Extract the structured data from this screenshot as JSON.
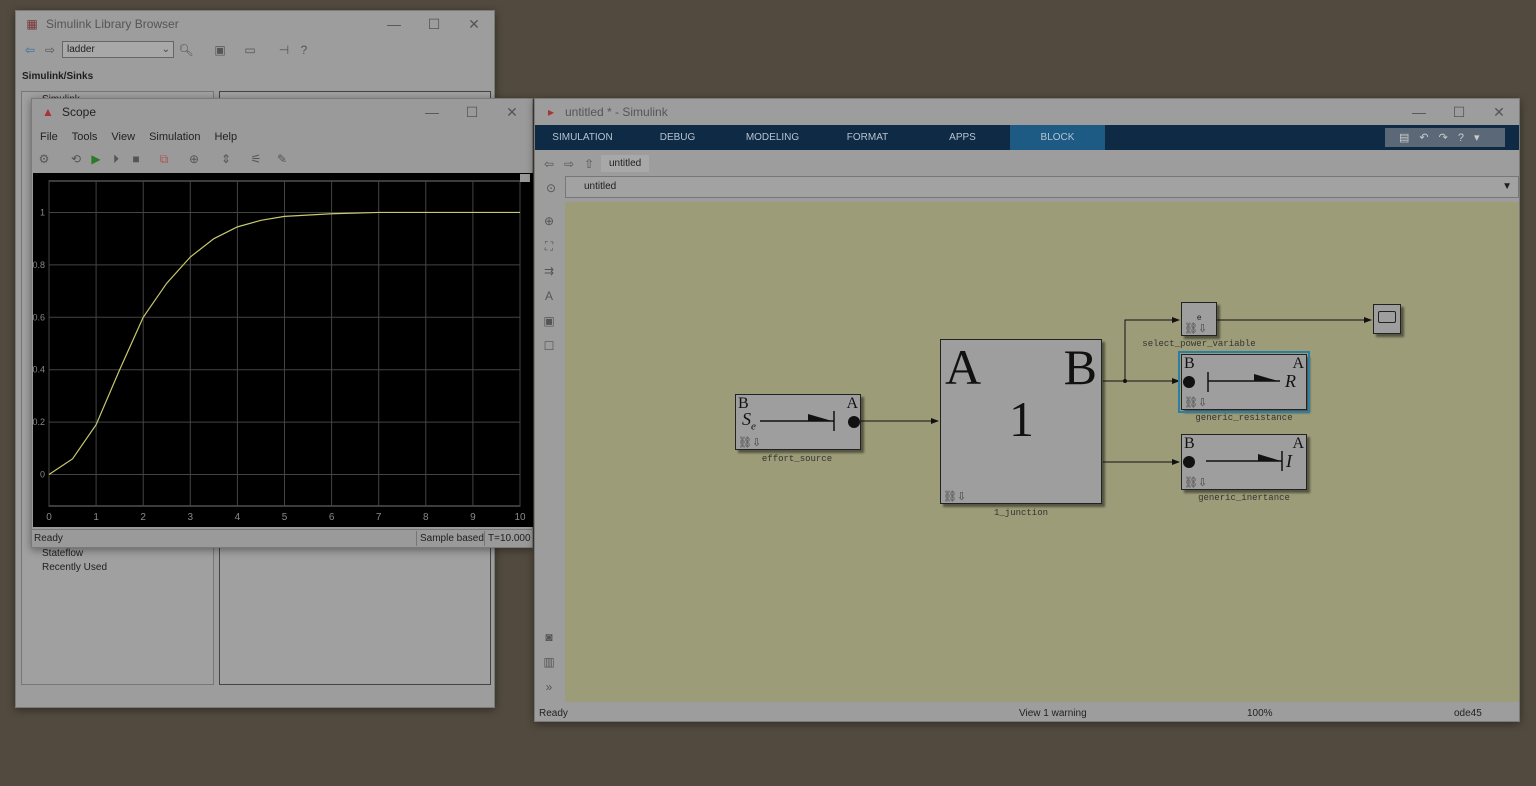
{
  "library_browser": {
    "title": "Simulink Library Browser",
    "search_value": "ladder",
    "path": "Simulink/Sinks",
    "tree": [
      "Simulink",
      "Stateflow",
      "Recently Used"
    ]
  },
  "scope": {
    "title": "Scope",
    "menu": [
      "File",
      "Tools",
      "View",
      "Simulation",
      "Help"
    ],
    "status": "Ready",
    "sample_mode": "Sample based",
    "time": "T=10.000",
    "line_color": "#c8c870"
  },
  "chart_data": {
    "type": "line",
    "x": [
      0,
      0.5,
      1,
      1.5,
      2,
      2.5,
      3,
      3.5,
      4,
      4.5,
      5,
      6,
      7,
      8,
      9,
      10
    ],
    "values": [
      0,
      0.06,
      0.19,
      0.4,
      0.6,
      0.73,
      0.83,
      0.9,
      0.945,
      0.97,
      0.985,
      0.995,
      1,
      1,
      1,
      1
    ],
    "xlim": [
      0,
      10
    ],
    "ylim": [
      -0.12,
      1.12
    ],
    "xticks": [
      "0",
      "1",
      "2",
      "3",
      "4",
      "5",
      "6",
      "7",
      "8",
      "9",
      "10"
    ],
    "yticks": [
      "0",
      "0.2",
      "0.4",
      "0.6",
      "0.8",
      "1"
    ],
    "grid": true,
    "background": "#000000"
  },
  "simulink": {
    "title": "untitled * - Simulink",
    "tabs": [
      "SIMULATION",
      "DEBUG",
      "MODELING",
      "FORMAT",
      "APPS",
      "BLOCK"
    ],
    "active_tab": "BLOCK",
    "breadcrumb_tab": "untitled",
    "address": "untitled",
    "status": {
      "left": "Ready",
      "warning": "View 1 warning",
      "zoom": "100%",
      "solver": "ode45"
    },
    "blocks": {
      "effort_source": "effort_source",
      "junction": "1_junction",
      "select": "select_power_variable",
      "resistance": "generic_resistance",
      "inertance": "generic_inertance"
    },
    "glyphs": {
      "a": "A",
      "b": "B",
      "one": "1",
      "se": "S",
      "se_sub": "e",
      "r": "R",
      "i": "I",
      "e": "e"
    },
    "colors": {
      "ribbon": "#0e2a45",
      "active_tab": "#1d5b85",
      "canvas": "#9c9c78",
      "selection": "#2a7fa8"
    }
  }
}
